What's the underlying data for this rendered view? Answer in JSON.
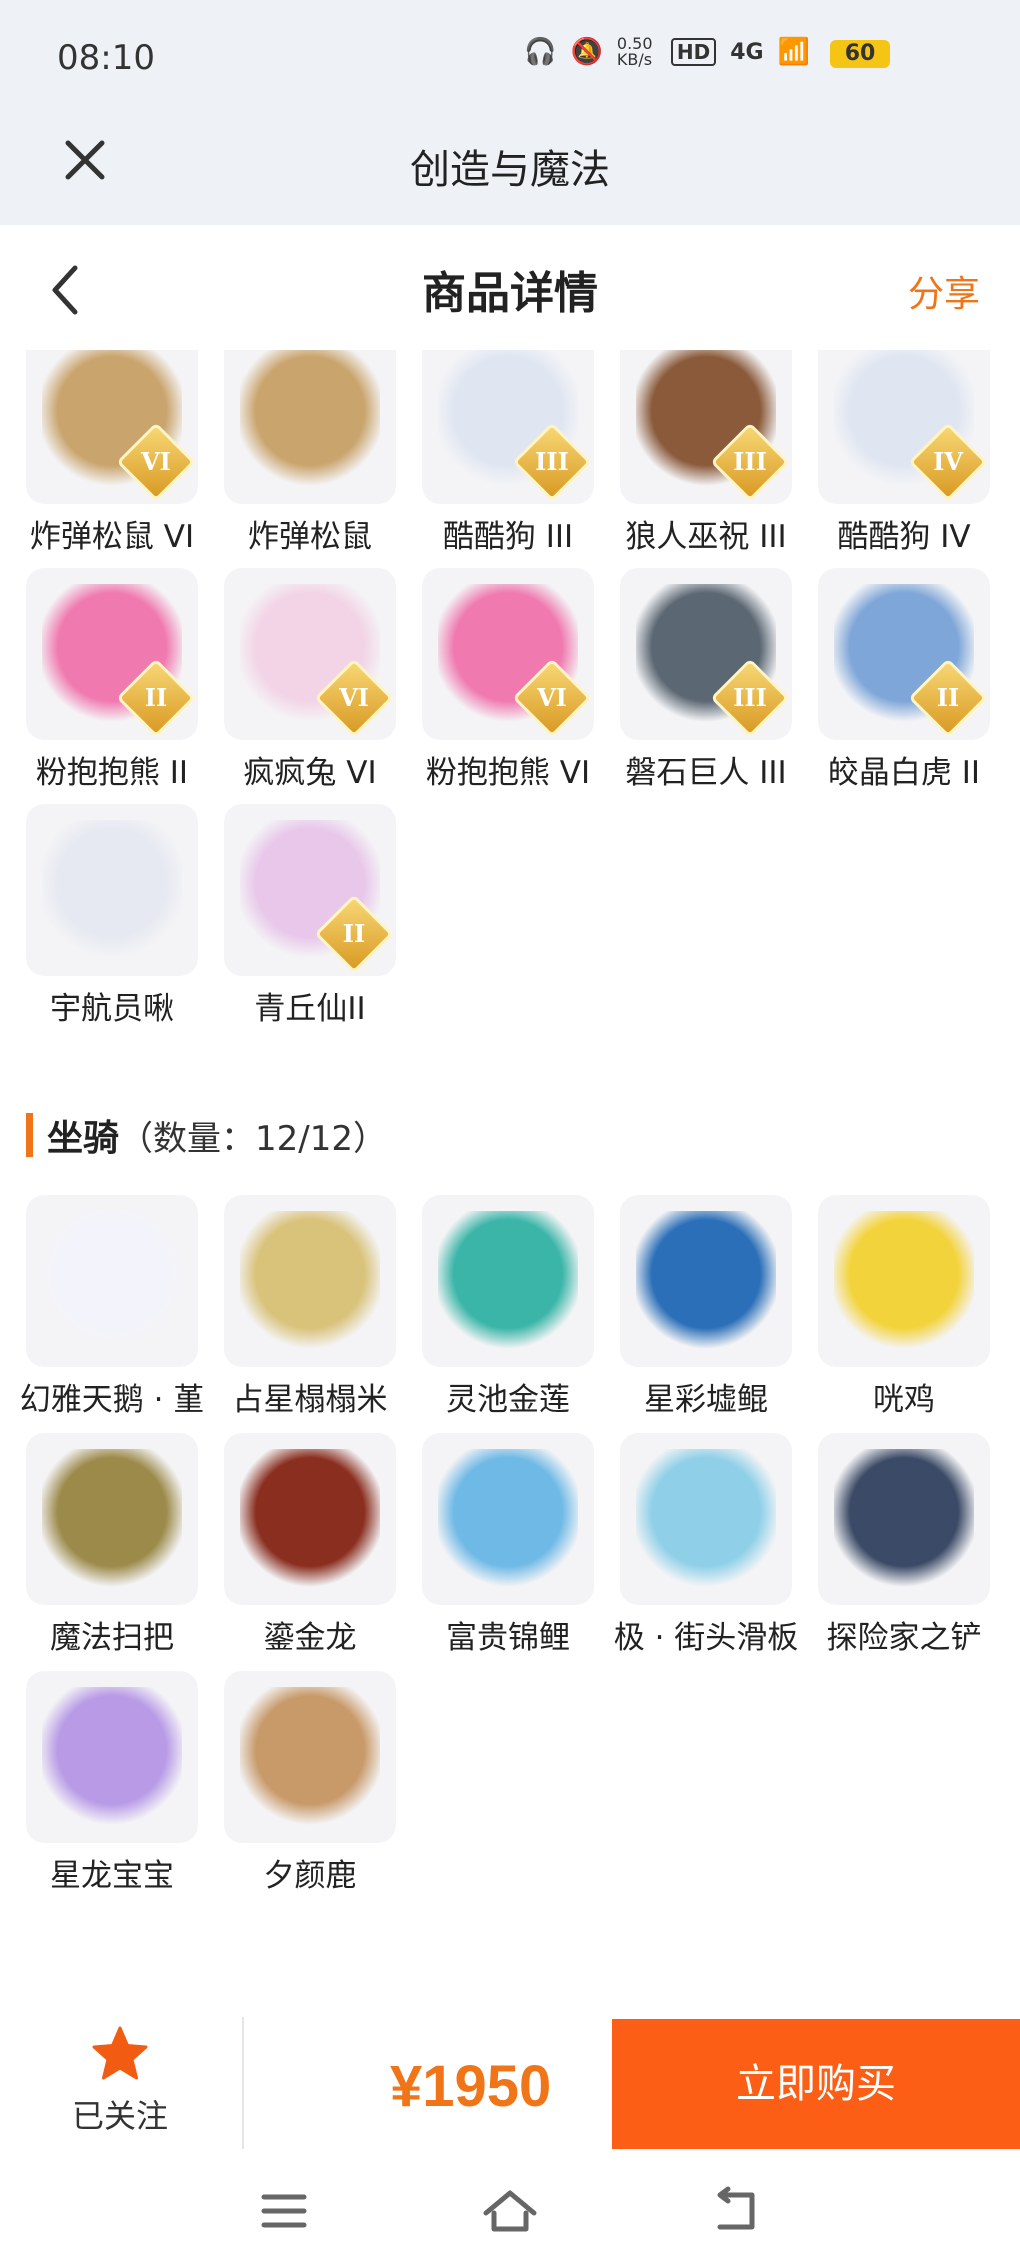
{
  "status_bar": {
    "time": "08:10",
    "net_speed": "0.50 KB/s",
    "hd": "HD",
    "signal": "4G",
    "battery": "60"
  },
  "app_bar": {
    "title": "创造与魔法"
  },
  "header": {
    "title": "商品详情",
    "share": "分享"
  },
  "pets": [
    {
      "name": "炸弹松鼠 VI",
      "badge": "VI",
      "color": "#c9a46c"
    },
    {
      "name": "炸弹松鼠",
      "badge": "",
      "color": "#c9a46c"
    },
    {
      "name": "酷酷狗 III",
      "badge": "III",
      "color": "#dfe6f2"
    },
    {
      "name": "狼人巫祝 III",
      "badge": "III",
      "color": "#8a5a3a"
    },
    {
      "name": "酷酷狗 IV",
      "badge": "IV",
      "color": "#dfe6f2"
    },
    {
      "name": "粉抱抱熊 II",
      "badge": "II",
      "color": "#f07ab0"
    },
    {
      "name": "疯疯兔 VI",
      "badge": "VI",
      "color": "#f3d4e6"
    },
    {
      "name": "粉抱抱熊 VI",
      "badge": "VI",
      "color": "#f07ab0"
    },
    {
      "name": "磐石巨人 III",
      "badge": "III",
      "color": "#5b6773"
    },
    {
      "name": "皎晶白虎 II",
      "badge": "II",
      "color": "#7ea6d8"
    },
    {
      "name": "宇航员啾",
      "badge": "",
      "color": "#e7e9f2"
    },
    {
      "name": "青丘仙II",
      "badge": "II",
      "color": "#e8c7ea"
    }
  ],
  "mounts_section": {
    "title": "坐骑",
    "count": "（数量：12/12）"
  },
  "mounts": [
    {
      "name": "幻雅天鹅 · 堇",
      "color": "#f3f3fb"
    },
    {
      "name": "占星榻榻米",
      "color": "#d9c27a"
    },
    {
      "name": "灵池金莲",
      "color": "#3ab5a8"
    },
    {
      "name": "星彩墟鲲",
      "color": "#2b6fb8"
    },
    {
      "name": "咣鸡",
      "color": "#f3d33b"
    },
    {
      "name": "魔法扫把",
      "color": "#9c8a4a"
    },
    {
      "name": "鎏金龙",
      "color": "#8a2e1f"
    },
    {
      "name": "富贵锦鲤",
      "color": "#6fb9e6"
    },
    {
      "name": "极 · 街头滑板",
      "color": "#8fd0e8"
    },
    {
      "name": "探险家之铲",
      "color": "#3b4a66"
    },
    {
      "name": "星龙宝宝",
      "color": "#b89ae6"
    },
    {
      "name": "夕颜鹿",
      "color": "#c89a6a"
    }
  ],
  "bottom_bar": {
    "follow_label": "已关注",
    "price": "¥1950",
    "buy_label": "立即购买"
  },
  "colors": {
    "accent": "#f07418",
    "buy": "#fb5e14",
    "star": "#f25c12"
  }
}
